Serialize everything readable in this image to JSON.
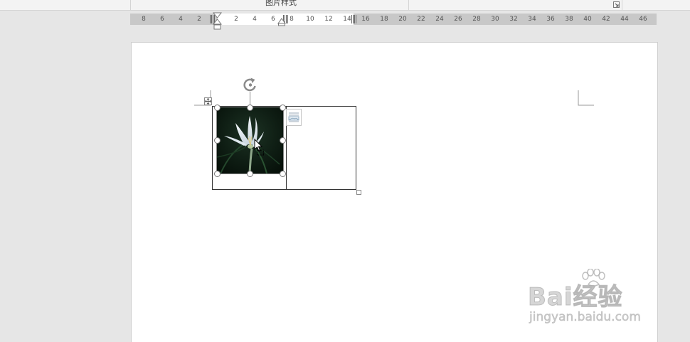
{
  "ribbon": {
    "group_label": "图片样式",
    "dialog_launcher_icon": "dialog-launcher-icon"
  },
  "ruler": {
    "left_numbers": [
      "8",
      "6",
      "4",
      "2"
    ],
    "inner_numbers": [
      "2",
      "4",
      "6",
      "8",
      "10",
      "12",
      "14"
    ],
    "right_numbers": [
      "16",
      "18",
      "20",
      "22",
      "24",
      "26",
      "28",
      "30",
      "32",
      "34",
      "36",
      "38",
      "40",
      "42",
      "44",
      "46"
    ]
  },
  "picture": {
    "subject": "white flower photo",
    "rotate_icon": "rotate-icon",
    "layout_icon": "layout-options-icon"
  },
  "watermark": {
    "brand": "Bai经验",
    "url": "jingyan.baidu.com"
  }
}
